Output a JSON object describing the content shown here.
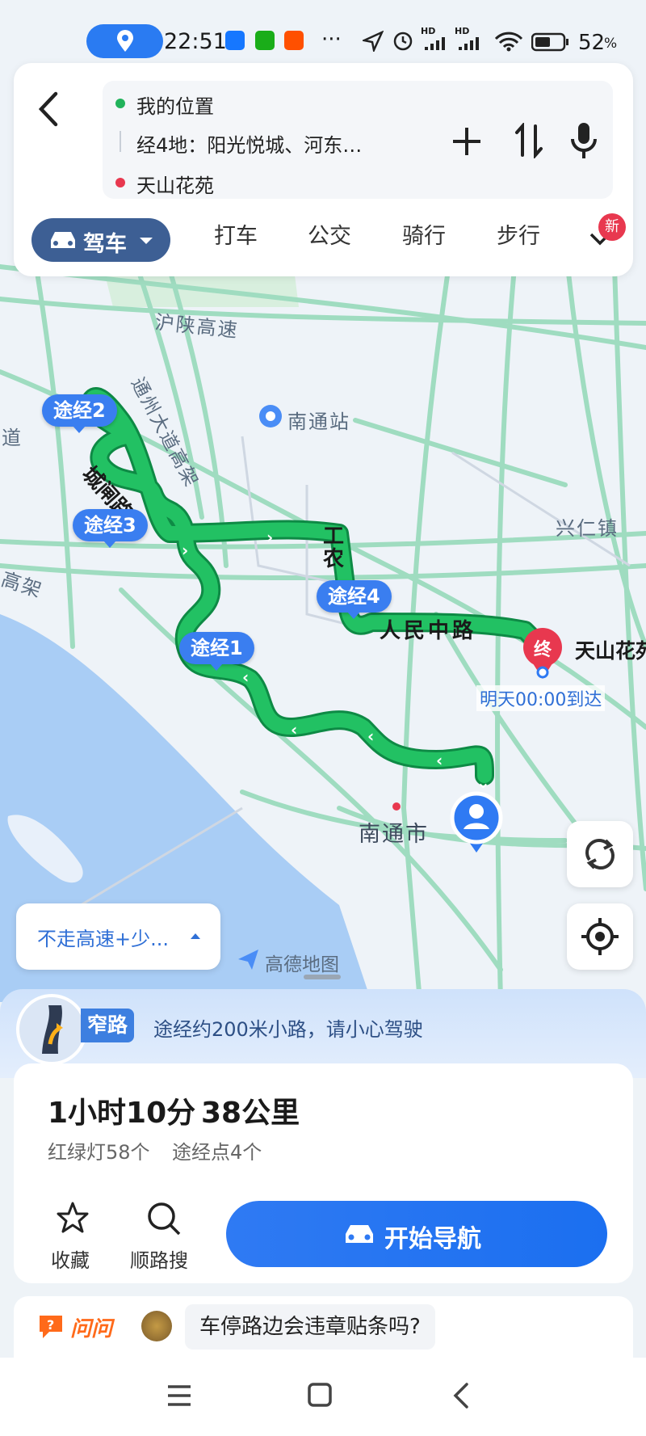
{
  "status_bar": {
    "time": "22:51",
    "battery": "52",
    "battery_unit": "%",
    "hd1": "HD",
    "hd2": "HD",
    "more": "···"
  },
  "route_input": {
    "origin": "我的位置",
    "waypoint": "经4地：阳光悦城、河东…",
    "destination": "天山花苑"
  },
  "mode_tabs": {
    "active": "驾车",
    "items": [
      "打车",
      "公交",
      "骑行",
      "步行"
    ],
    "new_badge": "新"
  },
  "map": {
    "labels": {
      "highway": "沪陕高速",
      "tongzhou": "通州大道高架",
      "station": "南通站",
      "xingren": "兴仁镇",
      "gaojia": "高架",
      "city": "南通市",
      "road_chengzha": "城闸路",
      "road_gongnong": "工农",
      "road_renmin": "人民中路",
      "dao": "道"
    },
    "waypoints": [
      "途经2",
      "途经3",
      "途经4",
      "途经1"
    ],
    "destination_marker": "终",
    "destination_name": "天山花苑",
    "arrival": "明天00:00到达",
    "brand": "高德地图",
    "route_preference": "不走高速+少..."
  },
  "notice": {
    "badge": "窄路",
    "text": "途经约200米小路，请小心驾驶"
  },
  "route_summary": {
    "duration": "1小时10分",
    "distance": "38公里",
    "traffic_lights": "红绿灯58个",
    "waypoint_count": "途经点4个"
  },
  "actions": {
    "favorite": "收藏",
    "search_along": "顺路搜",
    "start_nav": "开始导航"
  },
  "ask": {
    "logo": "问问",
    "question": "车停路边会违章贴条吗?"
  },
  "colors": {
    "route_green": "#1fb55a",
    "accent_blue": "#2f7af3",
    "destination_red": "#e8384f"
  }
}
